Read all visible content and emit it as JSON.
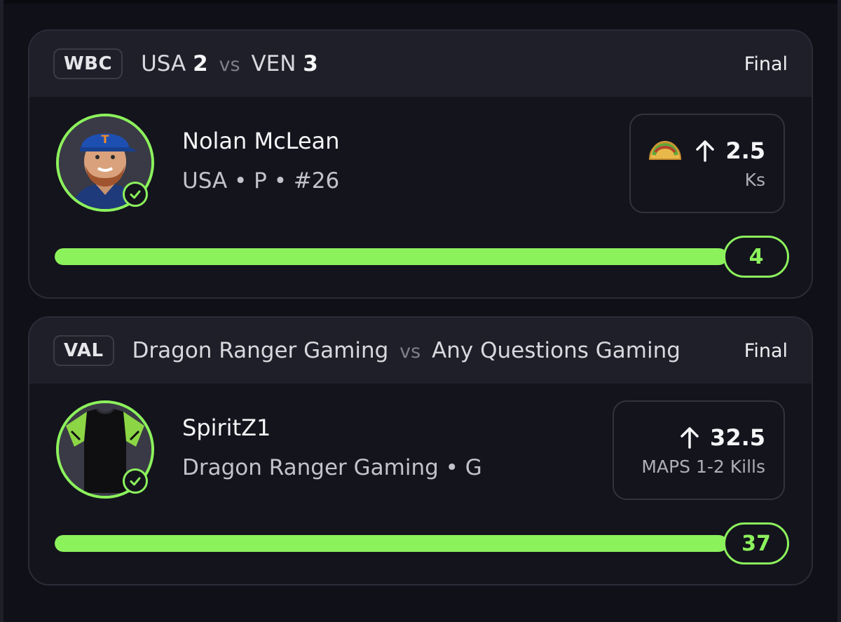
{
  "colors": {
    "accent_green": "#8cf25c",
    "background": "#101019",
    "card_bg": "#14141d",
    "header_bg": "#1f1f29"
  },
  "cards": [
    {
      "league": "WBC",
      "away_team": "USA",
      "away_score": "2",
      "vs": "vs",
      "home_team": "VEN",
      "home_score": "3",
      "status": "Final",
      "player": {
        "name": "Nolan McLean",
        "meta": "USA • P • #26",
        "avatar_icon": "player-headshot",
        "verified_icon": "check-circle-icon"
      },
      "line": {
        "icons": [
          "taco-icon",
          "arrow-up-icon"
        ],
        "value": "2.5",
        "stat": "Ks"
      },
      "result": "4",
      "progress_fraction": 1.0
    },
    {
      "league": "VAL",
      "away_team": "Dragon Ranger Gaming",
      "vs": "vs",
      "home_team": "Any Questions Gaming",
      "status": "Final",
      "player": {
        "name": "SpiritZ1",
        "meta": "Dragon Ranger Gaming • G",
        "avatar_icon": "jersey-icon",
        "verified_icon": "check-circle-icon"
      },
      "line": {
        "icons": [
          "arrow-up-icon"
        ],
        "value": "32.5",
        "stat": "MAPS 1-2 Kills"
      },
      "result": "37",
      "progress_fraction": 1.0
    }
  ]
}
